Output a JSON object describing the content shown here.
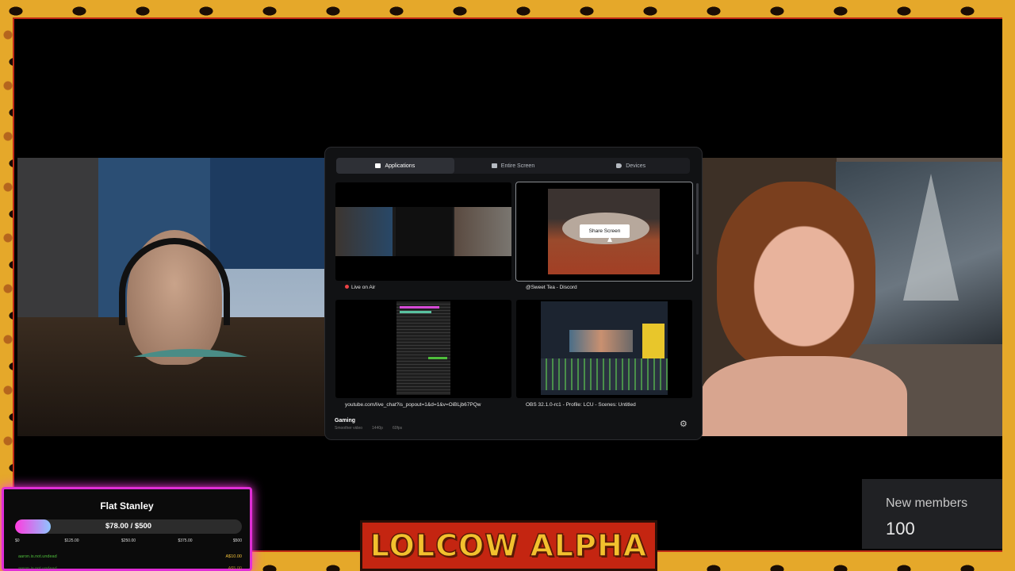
{
  "dialog": {
    "tabs": [
      {
        "label": "Applications",
        "icon": "window-icon",
        "active": true
      },
      {
        "label": "Entire Screen",
        "icon": "monitor-icon",
        "active": false
      },
      {
        "label": "Devices",
        "icon": "camera-icon",
        "active": false
      }
    ],
    "sources": [
      {
        "label": "Live on Air",
        "live": true
      },
      {
        "label": "@Sweet Tea - Discord",
        "selected": true
      },
      {
        "label": "youtube.com/live_chat?is_popout=1&d=1&v=OiBLjb67PQw"
      },
      {
        "label": "OBS 32.1.0-rc1 - Profile: LCU - Scenes: Untitled"
      }
    ],
    "share_button": "Share Screen",
    "quality": {
      "title": "Gaming",
      "subtitle": "Smoother video",
      "resolution": "1440p",
      "fps": "60fps"
    }
  },
  "goal": {
    "title": "Flat Stanley",
    "amount": "$78.00 / $500",
    "progress": 0.156,
    "ticks": [
      "$0",
      "$125.00",
      "$250.00",
      "$375.00",
      "$500"
    ],
    "donors": [
      {
        "name": "aaron.is.not.undead",
        "amount": "A$10.00"
      },
      {
        "name": "aaron.is.not.undead",
        "amount": "A$5.00"
      }
    ]
  },
  "new_members": {
    "title": "New members",
    "count": "100"
  },
  "logo": "LOLCOW ALPHA",
  "colors": {
    "accent": "#e02dd6",
    "frame": "#e5a82a",
    "logo_bg": "#c42511",
    "logo_text": "#f2c12e"
  }
}
